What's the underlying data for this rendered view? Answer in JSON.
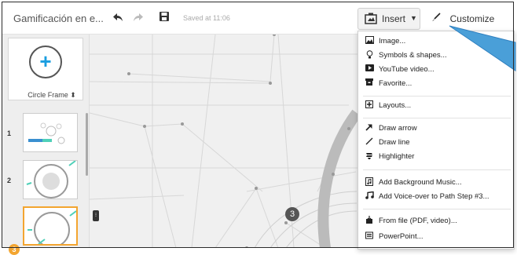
{
  "toolbar": {
    "title": "Gamificación en e...",
    "undo_icon": "undo-icon",
    "redo_icon": "redo-icon",
    "save_icon": "save-icon",
    "saved_text": "Saved at 11:06",
    "insert_label": "Insert",
    "customize_label": "Customize"
  },
  "left_panel": {
    "circle_frame_label": "Circle Frame ⬍",
    "slides": [
      {
        "number": "1"
      },
      {
        "number": "2"
      },
      {
        "number": "3"
      }
    ],
    "active_badge": "3"
  },
  "canvas": {
    "path_step": "3"
  },
  "insert_menu": {
    "groups": [
      [
        {
          "icon": "image-icon",
          "label": "Image..."
        },
        {
          "icon": "lightbulb-icon",
          "label": "Symbols & shapes..."
        },
        {
          "icon": "youtube-icon",
          "label": "YouTube video..."
        },
        {
          "icon": "favorite-icon",
          "label": "Favorite..."
        }
      ],
      [
        {
          "icon": "layouts-icon",
          "label": "Layouts..."
        }
      ],
      [
        {
          "icon": "arrow-icon",
          "label": "Draw arrow"
        },
        {
          "icon": "line-icon",
          "label": "Draw line"
        },
        {
          "icon": "highlighter-icon",
          "label": "Highlighter"
        }
      ],
      [
        {
          "icon": "music-file-icon",
          "label": "Add Background Music..."
        },
        {
          "icon": "music-note-icon",
          "label": "Add Voice-over to Path Step #3..."
        }
      ],
      [
        {
          "icon": "file-icon",
          "label": "From file (PDF, video)..."
        },
        {
          "icon": "powerpoint-icon",
          "label": "PowerPoint..."
        }
      ]
    ]
  },
  "colors": {
    "accent_blue": "#1a9ee0",
    "active_orange": "#f3a530",
    "callout_blue": "#4a9fd8"
  }
}
